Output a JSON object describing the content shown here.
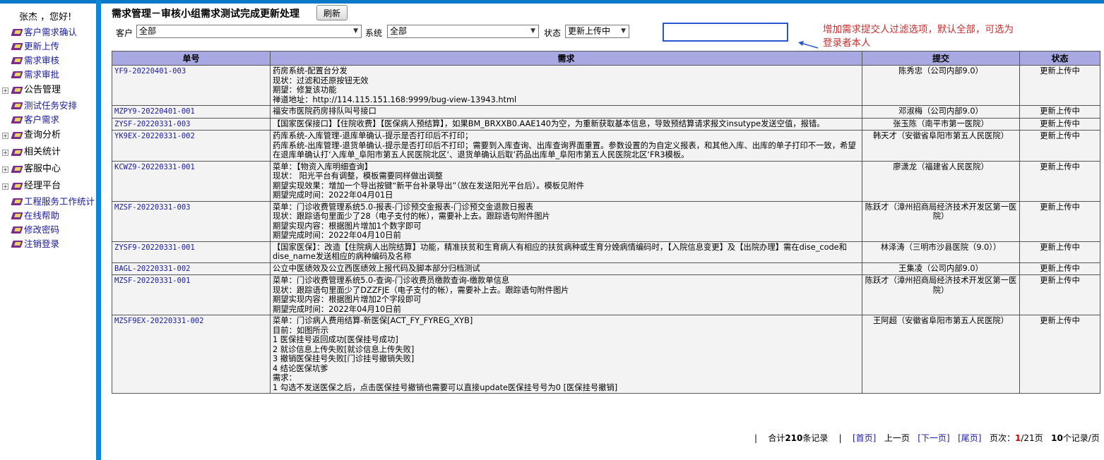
{
  "sidebar": {
    "greeting": "张杰 ，您好!",
    "items": [
      {
        "label": "客户需求确认",
        "type": "link"
      },
      {
        "label": "更新上传",
        "type": "link"
      },
      {
        "label": "需求审核",
        "type": "link"
      },
      {
        "label": "需求审批",
        "type": "link"
      },
      {
        "label": "公告管理",
        "type": "group"
      },
      {
        "label": "测试任务安排",
        "type": "link"
      },
      {
        "label": "客户需求",
        "type": "link"
      },
      {
        "label": "查询分析",
        "type": "group"
      },
      {
        "label": "相关统计",
        "type": "group"
      },
      {
        "label": "客服中心",
        "type": "group"
      },
      {
        "label": "经理平台",
        "type": "group"
      },
      {
        "label": "工程服务工作统计",
        "type": "link"
      },
      {
        "label": "在线帮助",
        "type": "link"
      },
      {
        "label": "修改密码",
        "type": "link"
      },
      {
        "label": "注销登录",
        "type": "link"
      }
    ]
  },
  "header": {
    "title": "需求管理－审核小组需求测试完成更新处理",
    "refresh_label": "刷新"
  },
  "filters": {
    "customer_label": "客户",
    "customer_value": "全部",
    "system_label": "系统",
    "system_value": "全部",
    "status_label": "状态",
    "status_value": "更新上传中"
  },
  "annotation": {
    "line1": "增加需求提交人过滤选项，默认全部，可选为",
    "line2": "登录者本人",
    "color": "#c33232"
  },
  "table": {
    "headers": [
      "单号",
      "需求",
      "提交",
      "状态"
    ],
    "rows": [
      {
        "id": "YF9-20220401-003",
        "demand": [
          "药房系统-配置台分发",
          "现状：过滤和还原按钮无效",
          "期望：修复该功能",
          "禅道地址：http://114.115.151.168:9999/bug-view-13943.html"
        ],
        "submitter": "陈秀忠（公司内部9.0）",
        "status": "更新上传中"
      },
      {
        "id": "MZPY9-20220401-001",
        "demand": [
          "福安市医院药房排队叫号接口"
        ],
        "submitter": "邓淑梅（公司内部9.0）",
        "status": "更新上传中"
      },
      {
        "id": "ZYSF-20220331-003",
        "demand": [
          "【国家医保接口】【住院收费】【医保病人预结算】，如果BM_BRXXB0.AAE140为空，为重新获取基本信息，导致预结算请求报文insutype发送空值，报错。"
        ],
        "submitter": "张玉陈（南平市第一医院）",
        "status": "更新上传中"
      },
      {
        "id": "YK9EX-20220331-002",
        "demand": [
          "药库系统-入库管理-退库单确认-提示是否打印后不打印；",
          "药库系统-出库管理-退货单确认-提示是否打印后不打印；需要到入库查询、出库查询界面重置。参数设置的为自定义报表，和其他入库、出库的单子打印不一致，希望在退库单确认打‘入库单_阜阳市第五人民医院北区‘、退货单确认后取’药品出库单_阜阳市第五人民医院北区‘FR3模板。"
        ],
        "submitter": "韩天才（安徽省阜阳市第五人民医院）",
        "status": "更新上传中"
      },
      {
        "id": "KCWZ9-20220331-001",
        "demand": [
          "菜单：【物资入库明细查询】",
          "现状： 阳光平台有调整，模板需要同样做出调整",
          "期望实现效果：增加一个导出按键“新平台补录导出”（放在发送阳光平台后）。模板见附件",
          "期望完成时间：2022年04月01日"
        ],
        "submitter": "廖潇龙（福建省人民医院）",
        "status": "更新上传中"
      },
      {
        "id": "MZSF-20220331-003",
        "demand": [
          "菜单：门诊收费管理系统5.0-报表-门诊预交金报表-门诊预交金退款日报表",
          "现状：跟踪语句里面少了28（电子支付的帐），需要补上去。跟踪语句附件图片",
          "期望实现内容：根据图片增加1个数字即可",
          "期望完成时间：2022年04月10日前"
        ],
        "submitter": "陈跃才（漳州招商局经济技术开发区第一医院）",
        "status": "更新上传中"
      },
      {
        "id": "ZYSF9-20220331-001",
        "demand": [
          "【国家医保】：改造【住院病人出院结算】功能，精准扶贫和生育病人有相应的扶贫病种或生育分娩病情编码时，【入院信息变更】及【出院办理】需在dise_code和dise_name发送相应的病种编码及名称"
        ],
        "submitter": "林泽涛（三明市沙县医院（9.0））",
        "status": "更新上传中"
      },
      {
        "id": "BAGL-20220331-002",
        "demand": [
          "公立中医绩效及公立西医绩效上报代码及脚本部分归档测试"
        ],
        "submitter": "王集凌（公司内部9.0）",
        "status": "更新上传中"
      },
      {
        "id": "MZSF-20220331-001",
        "demand": [
          "菜单：门诊收费管理系统5.0-查询-门诊收费员缴款查询-缴款单信息",
          "现状：跟踪语句里面少了DZZFJE（电子支付的帐），需要补上去。跟踪语句附件图片",
          "期望实现内容：根据图片增加2个字段即可",
          "期望完成时间：2022年04月10日前"
        ],
        "submitter": "陈跃才（漳州招商局经济技术开发区第一医院）",
        "status": "更新上传中"
      },
      {
        "id": "MZSF9EX-20220331-002",
        "demand": [
          "菜单：门诊病人费用结算-新医保[ACT_FY_FYREG_XYB]",
          "目前：如图所示",
          "1 医保挂号返回成功[医保挂号成功]",
          "2 就诊信息上传失败[就诊信息上传失败]",
          "3 撤销医保挂号失败[门诊挂号撤销失败]",
          "4 结论医保坑爹",
          "需求：",
          "1 勾选不发送医保之后，点击医保挂号撤销也需要可以直接update医保挂号号为0 [医保挂号撤销]"
        ],
        "submitter": "王阿超（安徽省阜阳市第五人民医院）",
        "status": "更新上传中"
      }
    ]
  },
  "pager": {
    "sep": "|",
    "total_prefix": "合计",
    "total": "210",
    "total_suffix": "条记录",
    "first": "[首页]",
    "prev": "上一页",
    "next": "[下一页]",
    "last": "[尾页]",
    "page_prefix": "页次：",
    "current_page": "1",
    "page_total": "/21页",
    "per_page": "10",
    "per_page_suffix": "个记录/页"
  }
}
